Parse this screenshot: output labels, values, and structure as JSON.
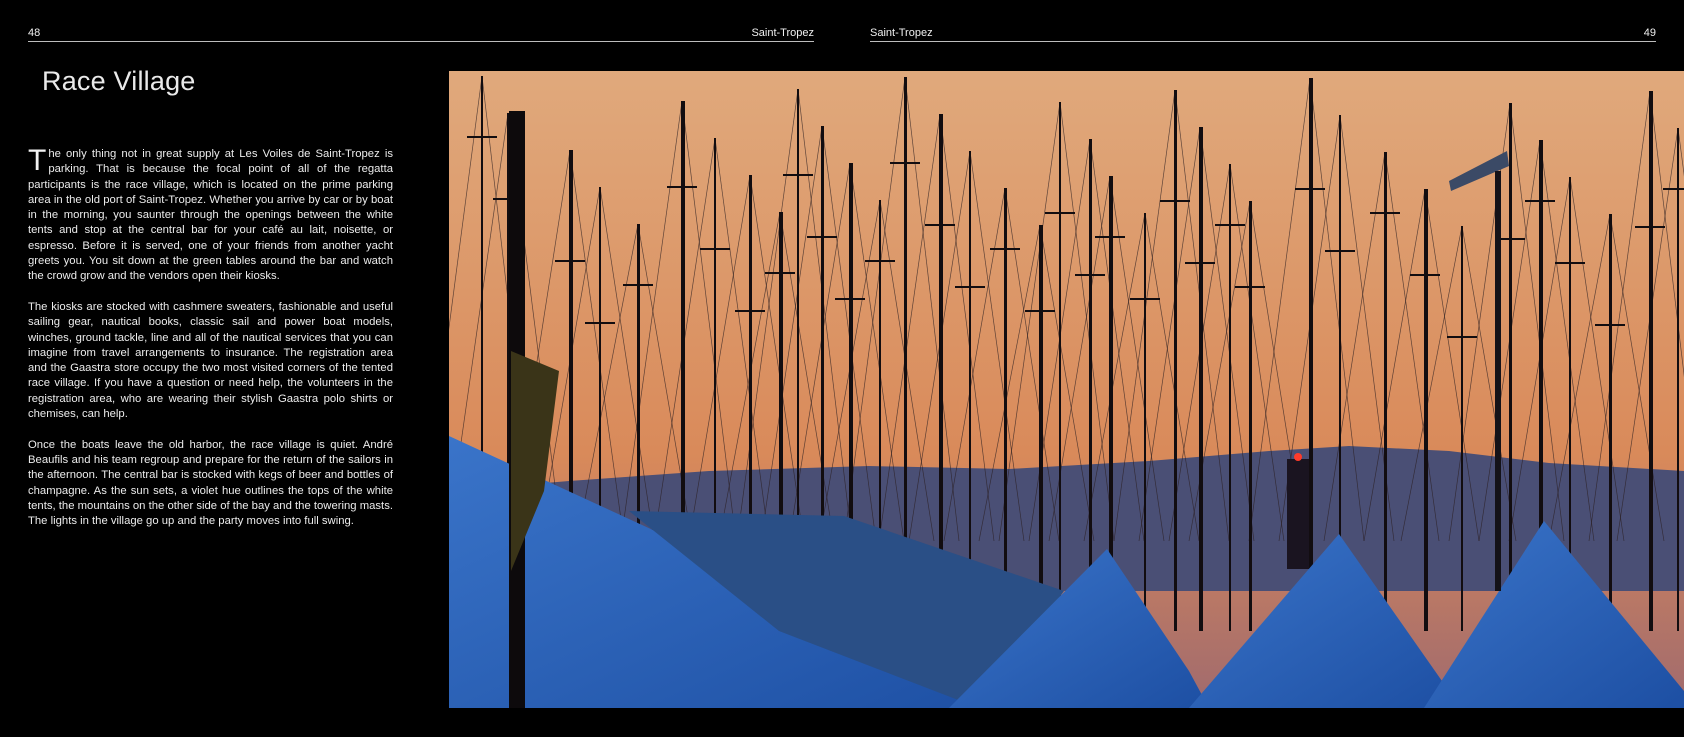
{
  "left_page": {
    "number": "48",
    "running_head": "Saint-Tropez",
    "title": "Race Village",
    "paragraphs": [
      {
        "dropcap": "T",
        "text": "he only thing not in great supply at Les Voiles de Saint-Tropez is parking.  That is because the focal point of all of the regatta participants is the race village, which is located on the prime parking area in the old port of Saint-Tropez.  Whether you arrive by car or by boat in the morning, you saunter through the openings between the white tents and stop at the central bar for your café au lait, noisette, or espresso.  Before it is served, one of your friends from another yacht greets you.  You sit down at the green tables around the bar and watch the crowd grow and the vendors open their kiosks."
      },
      {
        "dropcap": "",
        "text": "The kiosks are stocked with cashmere sweaters, fashionable and useful sailing gear, nautical books, classic sail and power boat models, winches, ground tackle, line and all of the nautical services that you can imagine from travel arrangements to insurance.  The registration area and the Gaastra store occupy the two most visited corners of the tented race village.  If you have a question or need help, the volunteers in the registration area, who are wearing their stylish Gaastra polo shirts or chemises, can help."
      },
      {
        "dropcap": "",
        "text": "Once the boats leave the old harbor, the race village is quiet.  André Beaufils and his team regroup and prepare for the return of the sailors in the afternoon.  The central bar is stocked with kegs of beer and bottles of champagne.  As the sun sets, a violet hue outlines the tops of the white tents, the mountains on the other side of the bay and the towering masts.  The lights in the village go up and the party moves into full swing."
      }
    ]
  },
  "right_page": {
    "number": "49",
    "running_head": "Saint-Tropez"
  },
  "photo": {
    "sky_top": "#e0a97c",
    "sky_mid": "#d98a5a",
    "sky_low": "#a06a6e",
    "mountain": "#4a4f75",
    "tent": "#1d4fa3",
    "tent_light": "#3a74c9",
    "mast": "#120d10"
  }
}
